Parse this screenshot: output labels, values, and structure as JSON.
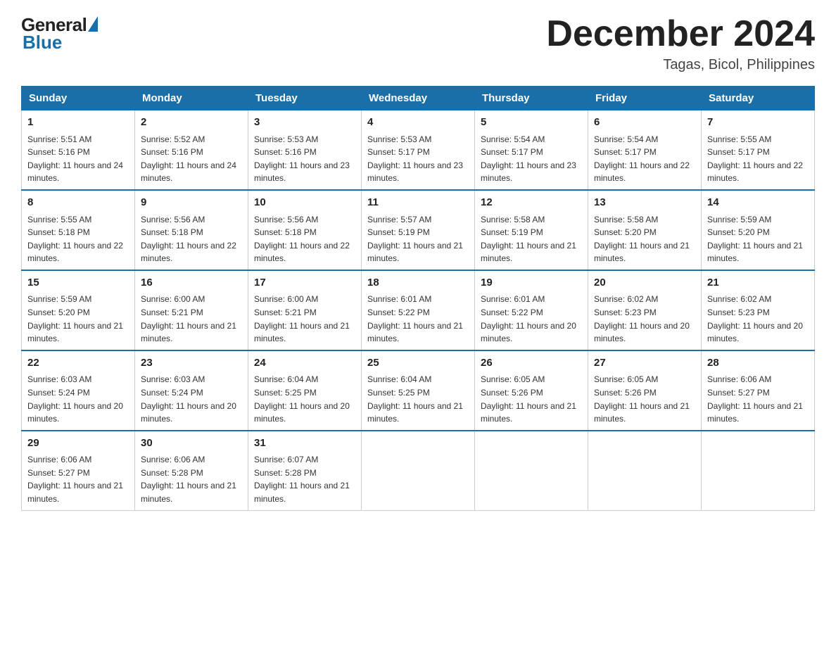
{
  "header": {
    "logo_general": "General",
    "logo_blue": "Blue",
    "month_title": "December 2024",
    "location": "Tagas, Bicol, Philippines"
  },
  "weekdays": [
    "Sunday",
    "Monday",
    "Tuesday",
    "Wednesday",
    "Thursday",
    "Friday",
    "Saturday"
  ],
  "weeks": [
    [
      {
        "day": "1",
        "sunrise": "5:51 AM",
        "sunset": "5:16 PM",
        "daylight": "11 hours and 24 minutes."
      },
      {
        "day": "2",
        "sunrise": "5:52 AM",
        "sunset": "5:16 PM",
        "daylight": "11 hours and 24 minutes."
      },
      {
        "day": "3",
        "sunrise": "5:53 AM",
        "sunset": "5:16 PM",
        "daylight": "11 hours and 23 minutes."
      },
      {
        "day": "4",
        "sunrise": "5:53 AM",
        "sunset": "5:17 PM",
        "daylight": "11 hours and 23 minutes."
      },
      {
        "day": "5",
        "sunrise": "5:54 AM",
        "sunset": "5:17 PM",
        "daylight": "11 hours and 23 minutes."
      },
      {
        "day": "6",
        "sunrise": "5:54 AM",
        "sunset": "5:17 PM",
        "daylight": "11 hours and 22 minutes."
      },
      {
        "day": "7",
        "sunrise": "5:55 AM",
        "sunset": "5:17 PM",
        "daylight": "11 hours and 22 minutes."
      }
    ],
    [
      {
        "day": "8",
        "sunrise": "5:55 AM",
        "sunset": "5:18 PM",
        "daylight": "11 hours and 22 minutes."
      },
      {
        "day": "9",
        "sunrise": "5:56 AM",
        "sunset": "5:18 PM",
        "daylight": "11 hours and 22 minutes."
      },
      {
        "day": "10",
        "sunrise": "5:56 AM",
        "sunset": "5:18 PM",
        "daylight": "11 hours and 22 minutes."
      },
      {
        "day": "11",
        "sunrise": "5:57 AM",
        "sunset": "5:19 PM",
        "daylight": "11 hours and 21 minutes."
      },
      {
        "day": "12",
        "sunrise": "5:58 AM",
        "sunset": "5:19 PM",
        "daylight": "11 hours and 21 minutes."
      },
      {
        "day": "13",
        "sunrise": "5:58 AM",
        "sunset": "5:20 PM",
        "daylight": "11 hours and 21 minutes."
      },
      {
        "day": "14",
        "sunrise": "5:59 AM",
        "sunset": "5:20 PM",
        "daylight": "11 hours and 21 minutes."
      }
    ],
    [
      {
        "day": "15",
        "sunrise": "5:59 AM",
        "sunset": "5:20 PM",
        "daylight": "11 hours and 21 minutes."
      },
      {
        "day": "16",
        "sunrise": "6:00 AM",
        "sunset": "5:21 PM",
        "daylight": "11 hours and 21 minutes."
      },
      {
        "day": "17",
        "sunrise": "6:00 AM",
        "sunset": "5:21 PM",
        "daylight": "11 hours and 21 minutes."
      },
      {
        "day": "18",
        "sunrise": "6:01 AM",
        "sunset": "5:22 PM",
        "daylight": "11 hours and 21 minutes."
      },
      {
        "day": "19",
        "sunrise": "6:01 AM",
        "sunset": "5:22 PM",
        "daylight": "11 hours and 20 minutes."
      },
      {
        "day": "20",
        "sunrise": "6:02 AM",
        "sunset": "5:23 PM",
        "daylight": "11 hours and 20 minutes."
      },
      {
        "day": "21",
        "sunrise": "6:02 AM",
        "sunset": "5:23 PM",
        "daylight": "11 hours and 20 minutes."
      }
    ],
    [
      {
        "day": "22",
        "sunrise": "6:03 AM",
        "sunset": "5:24 PM",
        "daylight": "11 hours and 20 minutes."
      },
      {
        "day": "23",
        "sunrise": "6:03 AM",
        "sunset": "5:24 PM",
        "daylight": "11 hours and 20 minutes."
      },
      {
        "day": "24",
        "sunrise": "6:04 AM",
        "sunset": "5:25 PM",
        "daylight": "11 hours and 20 minutes."
      },
      {
        "day": "25",
        "sunrise": "6:04 AM",
        "sunset": "5:25 PM",
        "daylight": "11 hours and 21 minutes."
      },
      {
        "day": "26",
        "sunrise": "6:05 AM",
        "sunset": "5:26 PM",
        "daylight": "11 hours and 21 minutes."
      },
      {
        "day": "27",
        "sunrise": "6:05 AM",
        "sunset": "5:26 PM",
        "daylight": "11 hours and 21 minutes."
      },
      {
        "day": "28",
        "sunrise": "6:06 AM",
        "sunset": "5:27 PM",
        "daylight": "11 hours and 21 minutes."
      }
    ],
    [
      {
        "day": "29",
        "sunrise": "6:06 AM",
        "sunset": "5:27 PM",
        "daylight": "11 hours and 21 minutes."
      },
      {
        "day": "30",
        "sunrise": "6:06 AM",
        "sunset": "5:28 PM",
        "daylight": "11 hours and 21 minutes."
      },
      {
        "day": "31",
        "sunrise": "6:07 AM",
        "sunset": "5:28 PM",
        "daylight": "11 hours and 21 minutes."
      },
      null,
      null,
      null,
      null
    ]
  ]
}
